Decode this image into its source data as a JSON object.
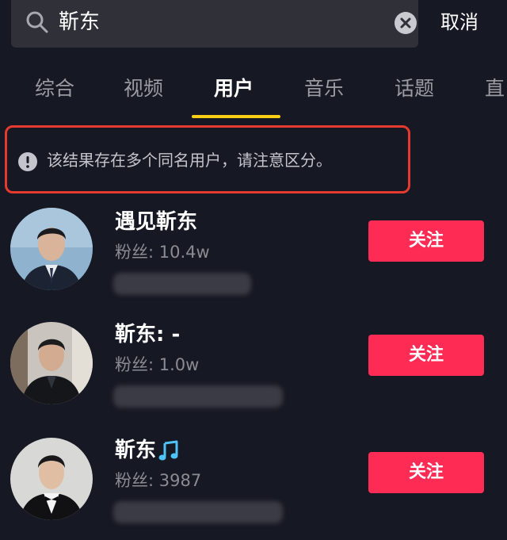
{
  "search": {
    "query": "靳东",
    "cancel_label": "取消"
  },
  "tabs": [
    {
      "label": "综合"
    },
    {
      "label": "视频"
    },
    {
      "label": "用户",
      "active": true
    },
    {
      "label": "音乐"
    },
    {
      "label": "话题"
    },
    {
      "label": "直"
    }
  ],
  "notice": {
    "text": "该结果存在多个同名用户，请注意区分。"
  },
  "users": [
    {
      "name": "遇见靳东",
      "fans": "粉丝: 10.4w",
      "follow_label": "关注"
    },
    {
      "name": "靳东: -",
      "fans": "粉丝: 1.0w",
      "follow_label": "关注"
    },
    {
      "name": "靳东",
      "fans": "粉丝: 3987",
      "follow_label": "关注",
      "badge_icon": "music-note-icon"
    }
  ],
  "colors": {
    "background": "#161823",
    "accent_underline": "#face15",
    "follow_button": "#fe2c55",
    "notice_border": "#e53a2f"
  }
}
